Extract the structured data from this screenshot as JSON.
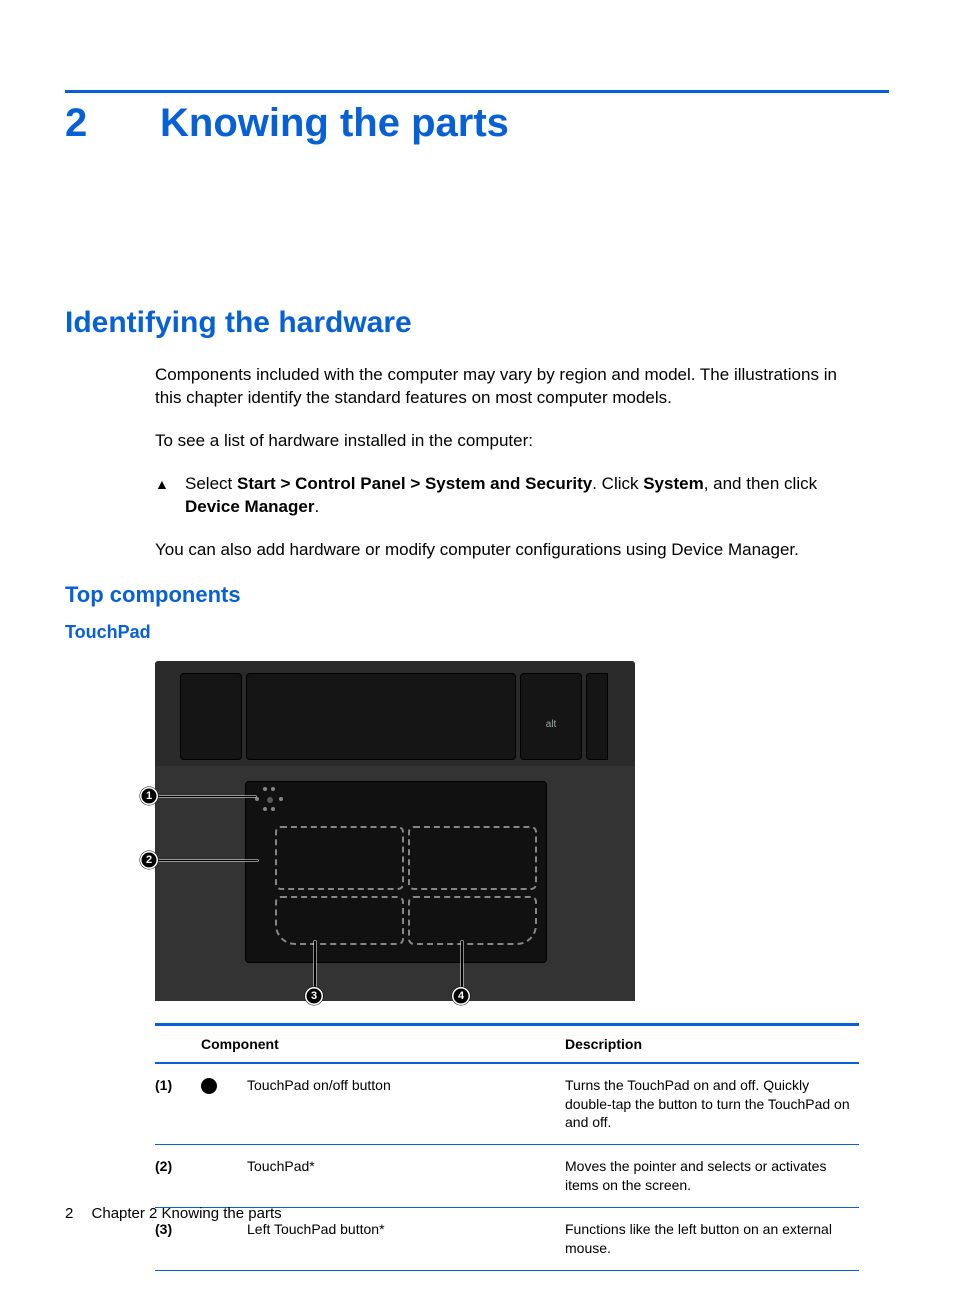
{
  "chapter": {
    "number": "2",
    "title": "Knowing the parts"
  },
  "section": {
    "title": "Identifying the hardware"
  },
  "paragraphs": {
    "intro": "Components included with the computer may vary by region and model. The illustrations in this chapter identify the standard features on most computer models.",
    "list_intro": "To see a list of hardware installed in the computer:",
    "after_step": "You can also add hardware or modify computer configurations using Device Manager."
  },
  "step": {
    "marker": "▲",
    "prefix": "Select ",
    "bold1": "Start > Control Panel > System and Security",
    "mid1": ". Click ",
    "bold2": "System",
    "mid2": ", and then click ",
    "bold3": "Device Manager",
    "suffix": "."
  },
  "subheads": {
    "top_components": "Top components",
    "touchpad": "TouchPad"
  },
  "diagram": {
    "key_label": "alt",
    "callouts": {
      "c1": "1",
      "c2": "2",
      "c3": "3",
      "c4": "4"
    }
  },
  "table": {
    "headers": {
      "component": "Component",
      "description": "Description"
    },
    "rows": [
      {
        "num": "(1)",
        "icon": "dot",
        "component": "TouchPad on/off button",
        "description": "Turns the TouchPad on and off. Quickly double-tap the button to turn the TouchPad on and off."
      },
      {
        "num": "(2)",
        "icon": "",
        "component": "TouchPad*",
        "description": "Moves the pointer and selects or activates items on the screen."
      },
      {
        "num": "(3)",
        "icon": "",
        "component": "Left TouchPad button*",
        "description": "Functions like the left button on an external mouse."
      }
    ]
  },
  "footer": {
    "page_num": "2",
    "label": "Chapter 2   Knowing the parts"
  }
}
